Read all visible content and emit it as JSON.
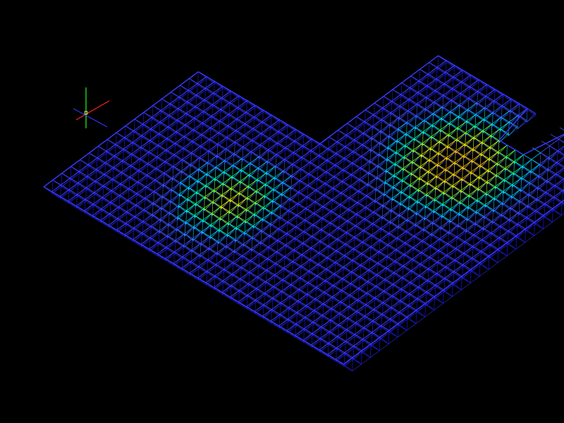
{
  "viewport": {
    "background": "#000000",
    "view_mode": "3d-isometric-wireframe",
    "grid_visible": false
  },
  "model": {
    "kind": "space-frame-grid-structure",
    "render_style": "wireframe",
    "coloring": "stress-contour",
    "layers": [
      "top-chord",
      "bottom-chord",
      "web-diagonals"
    ]
  },
  "contour_scale": {
    "colors": [
      "#1a1aff",
      "#2a5cff",
      "#00d0ff",
      "#00ffb0",
      "#7dff3a",
      "#e6ff00",
      "#ffd000"
    ],
    "visible_legend": false
  },
  "axis_triad": {
    "visible": true,
    "x_color": "#ff2020",
    "y_color": "#20ff20",
    "z_color": "#3030ff",
    "origin_marker_color": "#ffff66"
  },
  "chord_colors": {
    "top": "#4a4aff",
    "bottom": "#2a2ad8",
    "web_low": "#5a5aff",
    "web_high": "#ffe000"
  }
}
